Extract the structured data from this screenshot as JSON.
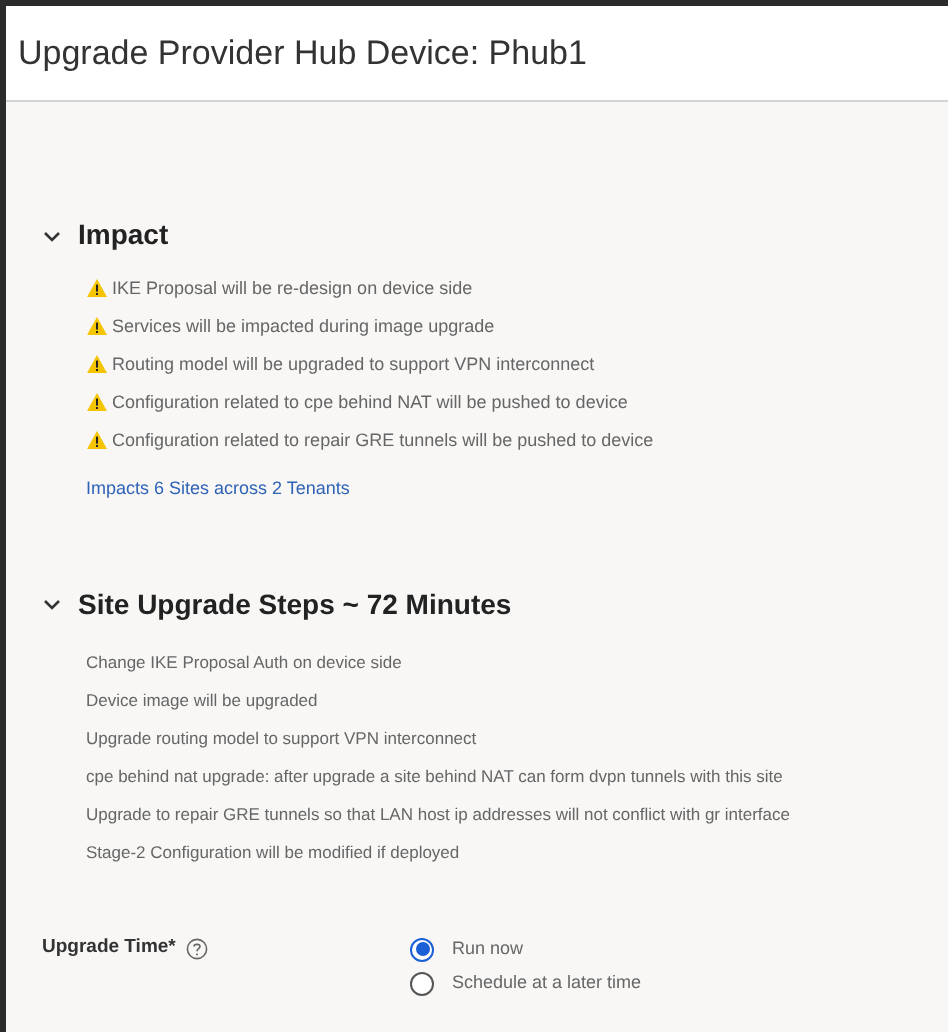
{
  "title": "Upgrade Provider Hub Device: Phub1",
  "impact": {
    "heading": "Impact",
    "expanded": true,
    "items": [
      "IKE Proposal will be re-design on device side",
      "Services will be impacted during image upgrade",
      "Routing model will be upgraded to support VPN interconnect",
      "Configuration related to cpe behind NAT will be pushed to device",
      "Configuration related to repair GRE tunnels will be pushed to device"
    ],
    "link": "Impacts 6 Sites across 2 Tenants"
  },
  "steps": {
    "heading": "Site Upgrade Steps ~ 72 Minutes",
    "expanded": true,
    "items": [
      "Change IKE Proposal Auth on device side",
      "Device image will be upgraded",
      "Upgrade routing model to support VPN interconnect",
      "cpe behind nat upgrade: after upgrade a site behind NAT can form dvpn tunnels with this site",
      "Upgrade to repair GRE tunnels so that LAN host ip addresses will not conflict with gr interface",
      "Stage-2 Configuration will be modified if deployed"
    ]
  },
  "upgrade_time": {
    "label": "Upgrade Time*",
    "options": [
      {
        "label": "Run now",
        "selected": true
      },
      {
        "label": "Schedule at a later time",
        "selected": false
      }
    ]
  }
}
